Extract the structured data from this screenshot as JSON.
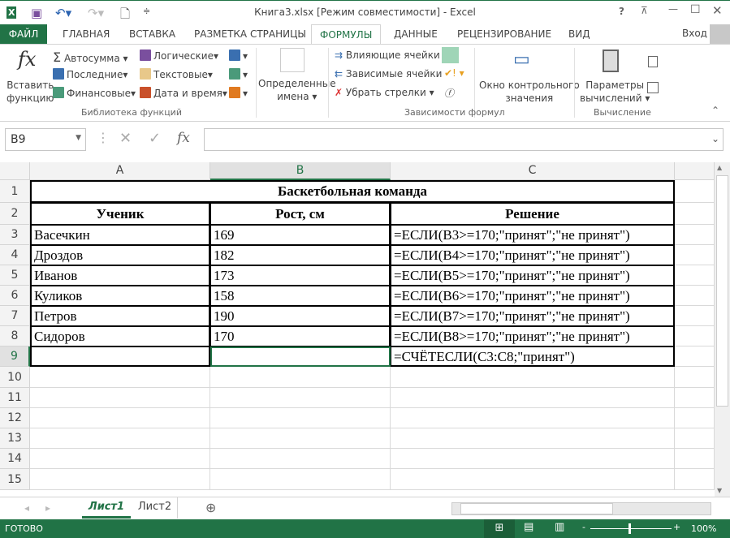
{
  "window": {
    "title": "Книга3.xlsx  [Режим совместимости] - Excel",
    "help": "?",
    "login": "Вход"
  },
  "tabs": [
    "ФАЙЛ",
    "ГЛАВНАЯ",
    "ВСТАВКА",
    "РАЗМЕТКА СТРАНИЦЫ",
    "ФОРМУЛЫ",
    "ДАННЫЕ",
    "РЕЦЕНЗИРОВАНИЕ",
    "ВИД"
  ],
  "ribbon": {
    "insert_function": [
      "Вставить",
      "функцию"
    ],
    "autosum": "Автосумма",
    "recent": "Последние",
    "financial": "Финансовые",
    "logical": "Логические",
    "text": "Текстовые",
    "datetime": "Дата и время",
    "library_label": "Библиотека функций",
    "defined_names": [
      "Определенные",
      "имена"
    ],
    "trace_precedents": "Влияющие ячейки",
    "trace_dependents": "Зависимые ячейки",
    "remove_arrows": "Убрать стрелки",
    "auditing_label": "Зависимости формул",
    "watch_window": [
      "Окно контрольного",
      "значения"
    ],
    "calc_options": [
      "Параметры",
      "вычислений"
    ],
    "calc_label": "Вычисление"
  },
  "formula_bar": {
    "name_box": "B9",
    "value": ""
  },
  "columns": [
    "A",
    "B",
    "C"
  ],
  "rows": [
    "1",
    "2",
    "3",
    "4",
    "5",
    "6",
    "7",
    "8",
    "9",
    "10",
    "11",
    "12",
    "13",
    "14",
    "15"
  ],
  "sheet": {
    "title": "Баскетбольная команда",
    "headers": [
      "Ученик",
      "Рост, см",
      "Решение"
    ],
    "data": [
      [
        "Васечкин",
        "169",
        "=ЕСЛИ(B3>=170;\"принят\";\"не принят\")"
      ],
      [
        "Дроздов",
        "182",
        "=ЕСЛИ(B4>=170;\"принят\";\"не принят\")"
      ],
      [
        "Иванов",
        "173",
        "=ЕСЛИ(B5>=170;\"принят\";\"не принят\")"
      ],
      [
        "Куликов",
        "158",
        "=ЕСЛИ(B6>=170;\"принят\";\"не принят\")"
      ],
      [
        "Петров",
        "190",
        "=ЕСЛИ(B7>=170;\"принят\";\"не принят\")"
      ],
      [
        "Сидоров",
        "170",
        "=ЕСЛИ(B8>=170;\"принят\";\"не принят\")"
      ],
      [
        "",
        "",
        "=СЧЁТЕСЛИ(C3:C8;\"принят\")"
      ]
    ]
  },
  "sheet_tabs": [
    "Лист1",
    "Лист2"
  ],
  "status": {
    "ready": "ГОТОВО",
    "zoom": "100%"
  },
  "colors": {
    "accent": "#217346"
  }
}
